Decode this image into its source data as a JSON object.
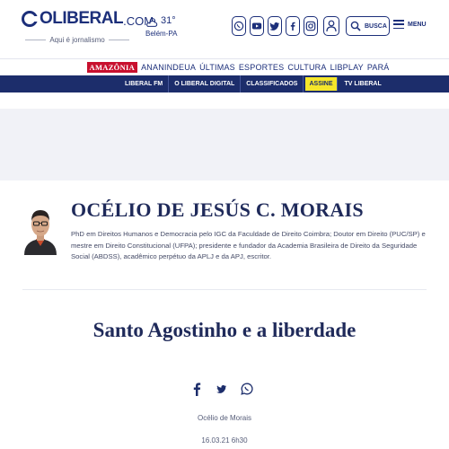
{
  "header": {
    "logo_text": "OLIBERAL",
    "logo_domain": ".COM",
    "tagline": "Aqui é jornalismo",
    "weather": {
      "temperature": "31°",
      "city": "Belém-PA",
      "icon": "cloud-sun-icon"
    },
    "social": [
      {
        "name": "whatsapp",
        "icon": "whatsapp-icon"
      },
      {
        "name": "youtube",
        "icon": "youtube-icon"
      },
      {
        "name": "twitter",
        "icon": "twitter-icon"
      },
      {
        "name": "facebook",
        "icon": "facebook-icon"
      },
      {
        "name": "instagram",
        "icon": "instagram-icon"
      }
    ],
    "user_icon": "user-icon",
    "search_label": "BUSCA",
    "menu_label": "MENU"
  },
  "nav_primary": {
    "brand_badge": "AMAZÔNIA",
    "items": [
      "ANANINDEUA",
      "ÚLTIMAS",
      "ESPORTES",
      "CULTURA",
      "LIBPLAY",
      "PARÁ"
    ]
  },
  "nav_secondary": {
    "items": [
      "LIBERAL FM",
      "O LIBERAL DIGITAL",
      "CLASSIFICADOS",
      "ASSINE",
      "TV LIBERAL"
    ]
  },
  "author": {
    "name": "OCÉLIO DE JESÚS C. MORAIS",
    "bio": "PhD em Direitos Humanos e Democracia pelo IGC da Faculdade de Direito Coimbra; Doutor em Direito (PUC/SP) e mestre em Direito Constitucional (UFPA); presidente e fundador da Academia Brasileira de Direito da Seguridade Social (ABDSS), acadêmico perpétuo da APLJ e da APJ, escritor."
  },
  "article": {
    "title": "Santo Agostinho e a liberdade",
    "share": [
      "facebook-icon",
      "twitter-icon",
      "whatsapp-icon"
    ],
    "byline": "Océlio de Morais",
    "date": "16.03.21 6h30"
  },
  "colors": {
    "brand_navy": "#1c2d6b",
    "amazonia_red": "#c8102e",
    "assine_yellow": "#f5e62a"
  }
}
